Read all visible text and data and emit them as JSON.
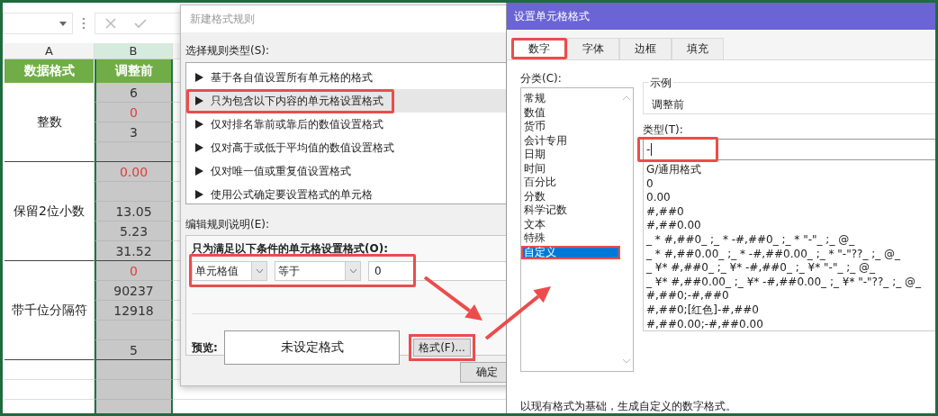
{
  "sheet": {
    "columns": [
      {
        "label": "A",
        "selected": false
      },
      {
        "label": "B",
        "selected": true
      }
    ],
    "header": [
      "数据格式",
      "调整前"
    ],
    "groups": [
      {
        "label": "整数",
        "values": [
          {
            "kind": "value",
            "text": "6",
            "color": "#333333"
          },
          {
            "kind": "value",
            "text": "0",
            "color": "#e03c3c"
          },
          {
            "kind": "value",
            "text": "3",
            "color": "#333333"
          },
          {
            "kind": "blank"
          }
        ]
      },
      {
        "label": "保留2位小数",
        "values": [
          {
            "kind": "value",
            "text": "0.00",
            "color": "#e03c3c"
          },
          {
            "kind": "blank"
          },
          {
            "kind": "value",
            "text": "13.05",
            "color": "#333333"
          },
          {
            "kind": "value",
            "text": "5.23",
            "color": "#333333"
          },
          {
            "kind": "value",
            "text": "31.52",
            "color": "#333333"
          }
        ]
      },
      {
        "label": "带千位分隔符",
        "values": [
          {
            "kind": "value",
            "text": "0",
            "color": "#e03c3c"
          },
          {
            "kind": "value",
            "text": "90237",
            "color": "#333333"
          },
          {
            "kind": "value",
            "text": "12918",
            "color": "#333333"
          },
          {
            "kind": "blank"
          },
          {
            "kind": "value",
            "text": "5",
            "color": "#333333"
          }
        ]
      }
    ]
  },
  "rule_dialog": {
    "title": "新建格式规则",
    "rule_type_label": "选择规则类型(S):",
    "rule_types": [
      {
        "label": "基于各自值设置所有单元格的格式",
        "selected": false,
        "highlighted": false
      },
      {
        "label": "只为包含以下内容的单元格设置格式",
        "selected": true,
        "highlighted": true
      },
      {
        "label": "仅对排名靠前或靠后的数值设置格式",
        "selected": false,
        "highlighted": false
      },
      {
        "label": "仅对高于或低于平均值的数值设置格式",
        "selected": false,
        "highlighted": false
      },
      {
        "label": "仅对唯一值或重复值设置格式",
        "selected": false,
        "highlighted": false
      },
      {
        "label": "使用公式确定要设置格式的单元格",
        "selected": false,
        "highlighted": false
      }
    ],
    "description_label": "编辑规则说明(E):",
    "condition_title": "只为满足以下条件的单元格设置格式(O):",
    "condition": {
      "field": "单元格值",
      "operator": "等于",
      "value": "0",
      "highlighted": true
    },
    "preview_label": "预览:",
    "preview_text": "未设定格式",
    "format_button": {
      "label": "格式(F)...",
      "highlighted": true
    },
    "ok_button": "确定"
  },
  "format_dialog": {
    "title": "设置单元格格式",
    "tabs": [
      {
        "label": "数字",
        "selected": true,
        "highlighted": true
      },
      {
        "label": "字体",
        "selected": false,
        "highlighted": false
      },
      {
        "label": "边框",
        "selected": false,
        "highlighted": false
      },
      {
        "label": "填充",
        "selected": false,
        "highlighted": false
      }
    ],
    "category_label": "分类(C):",
    "categories": [
      {
        "label": "常规",
        "selected": false,
        "highlighted": false
      },
      {
        "label": "数值",
        "selected": false,
        "highlighted": false
      },
      {
        "label": "货币",
        "selected": false,
        "highlighted": false
      },
      {
        "label": "会计专用",
        "selected": false,
        "highlighted": false
      },
      {
        "label": "日期",
        "selected": false,
        "highlighted": false
      },
      {
        "label": "时间",
        "selected": false,
        "highlighted": false
      },
      {
        "label": "百分比",
        "selected": false,
        "highlighted": false
      },
      {
        "label": "分数",
        "selected": false,
        "highlighted": false
      },
      {
        "label": "科学记数",
        "selected": false,
        "highlighted": false
      },
      {
        "label": "文本",
        "selected": false,
        "highlighted": false
      },
      {
        "label": "特殊",
        "selected": false,
        "highlighted": false
      },
      {
        "label": "自定义",
        "selected": true,
        "highlighted": true
      }
    ],
    "sample_label": "示例",
    "sample_value": "调整前",
    "type_label": "类型(T):",
    "type_field": {
      "value": "-",
      "highlighted": true
    },
    "formats": [
      "G/通用格式",
      "0",
      "0.00",
      "#,##0",
      "#,##0.00",
      "_ * #,##0_ ;_ * -#,##0_ ;_ * \"-\"_ ;_ @_",
      "_ * #,##0.00_ ;_ * -#,##0.00_ ;_ * \"-\"??_ ;_ @_",
      "_ ¥* #,##0_ ;_ ¥* -#,##0_ ;_ ¥* \"-\"_ ;_ @_",
      "_ ¥* #,##0.00_ ;_ ¥* -#,##0.00_ ;_ ¥* \"-\"??_ ;_ @_",
      "#,##0;-#,##0",
      "#,##0;[红色]-#,##0",
      "#,##0.00;-#,##0.00"
    ],
    "description": "以现有格式为基础，生成自定义的数字格式。"
  }
}
